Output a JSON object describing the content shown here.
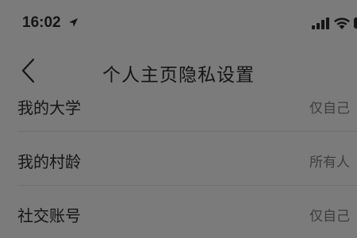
{
  "status_bar": {
    "time": "16:02",
    "location_icon": "location-arrow-icon",
    "signal_icon": "cellular-signal-icon",
    "wifi_icon": "wifi-icon",
    "battery_icon": "battery-icon"
  },
  "nav": {
    "back_icon": "chevron-left-icon",
    "title": "个人主页隐私设置"
  },
  "settings": {
    "items": [
      {
        "label": "我的大学",
        "value": "仅自己"
      },
      {
        "label": "我的村龄",
        "value": "所有人"
      },
      {
        "label": "社交账号",
        "value": "仅自己"
      }
    ]
  },
  "colors": {
    "background": "#7b7b7b",
    "text": "#151515",
    "secondary_text": "#3d3d3d",
    "divider": "#6f6f6f"
  }
}
